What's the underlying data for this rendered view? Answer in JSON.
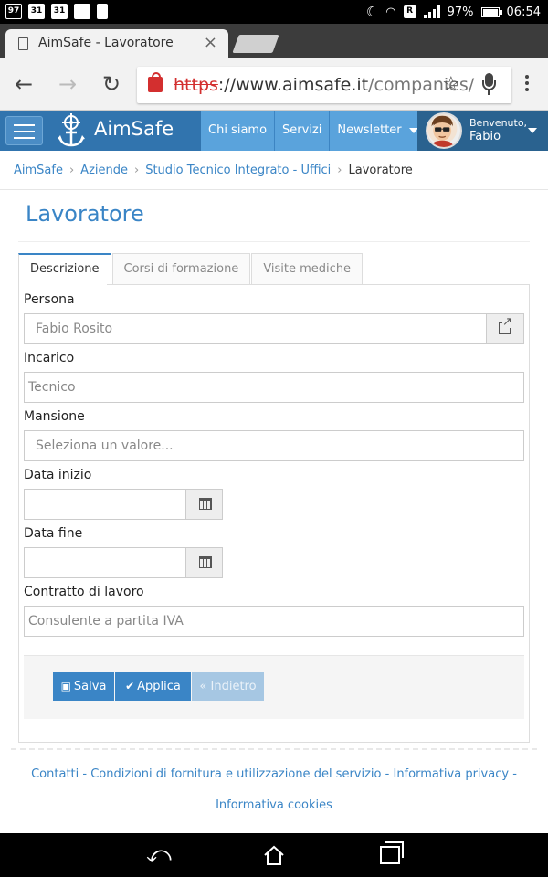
{
  "status_bar": {
    "left_icons": [
      "notification-97",
      "calendar-31",
      "calendar-31",
      "gallery",
      "file"
    ],
    "badge_text": "97",
    "cal1": "31",
    "cal2": "31",
    "battery": "97%",
    "time": "06:54"
  },
  "browser": {
    "tab_title": "AimSafe - Lavoratore",
    "tab_close": "×",
    "url_scheme": "https",
    "url_host": "://www.aimsafe.it",
    "url_path": "/companies/"
  },
  "navbar": {
    "brand": "AimSafe",
    "links": [
      "Chi siamo",
      "Servizi",
      "Newsletter"
    ],
    "welcome": "Benvenuto,",
    "user_name": "Fabio"
  },
  "breadcrumb": [
    "AimSafe",
    "Aziende",
    "Studio Tecnico Integrato - Uffici",
    "Lavoratore"
  ],
  "page_title": "Lavoratore",
  "tabs": [
    "Descrizione",
    "Corsi di formazione",
    "Visite mediche"
  ],
  "form": {
    "persona_label": "Persona",
    "persona_value": "Fabio Rosito",
    "incarico_label": "Incarico",
    "incarico_value": "Tecnico",
    "mansione_label": "Mansione",
    "mansione_placeholder": "Seleziona un valore...",
    "data_inizio_label": "Data inizio",
    "data_fine_label": "Data fine",
    "contratto_label": "Contratto di lavoro",
    "contratto_value": "Consulente a partita IVA"
  },
  "buttons": {
    "save": "Salva",
    "apply": "Applica",
    "back": "« Indietro"
  },
  "footer": {
    "contatti": "Contatti",
    "condizioni": "Condizioni di fornitura e utilizzazione del servizio",
    "privacy": "Informativa privacy",
    "cookies": "Informativa cookies",
    "separator": "-"
  },
  "colors": {
    "brand_blue": "#3174ae",
    "link_blue": "#3a85c6",
    "nav_link_bg": "#5aa3dc",
    "https_red": "#d32f2f"
  }
}
